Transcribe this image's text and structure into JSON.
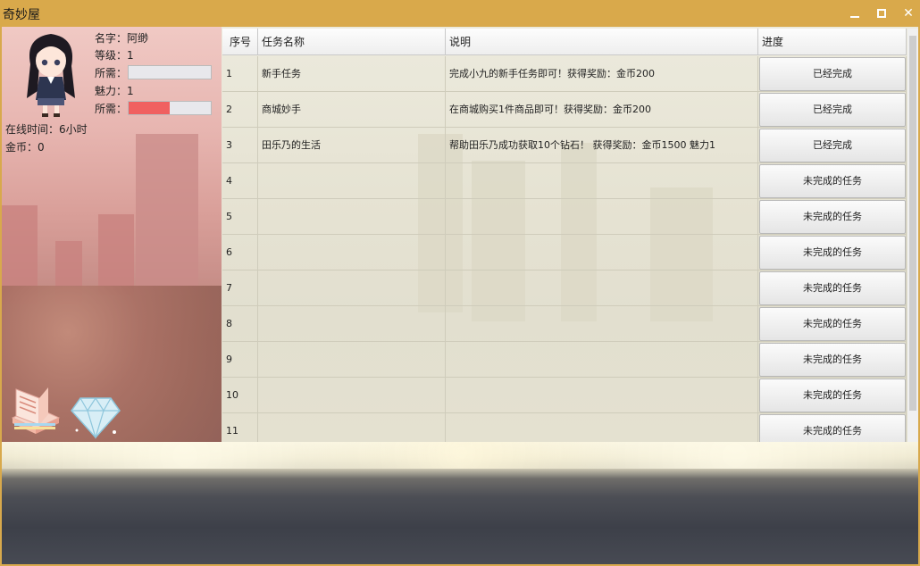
{
  "window": {
    "title": "奇妙屋"
  },
  "profile": {
    "name_label": "名字：阿缈",
    "level_label": "等级：1",
    "exp_label": "所需：",
    "exp_progress": 0.0,
    "charm_label": "魅力：1",
    "charm_need_label": "所需：",
    "charm_progress": 0.5,
    "online_label": "在线时间：6小时",
    "gold_label": "金币：0"
  },
  "table": {
    "headers": [
      "序号",
      "任务名称",
      "说明",
      "进度"
    ],
    "rows": [
      {
        "id": "1",
        "name": "新手任务",
        "desc": "完成小九的新手任务即可！获得奖励：金币200",
        "status": "已经完成"
      },
      {
        "id": "2",
        "name": "商城妙手",
        "desc": "在商城购买1件商品即可！获得奖励：金币200",
        "status": "已经完成"
      },
      {
        "id": "3",
        "name": "田乐乃的生活",
        "desc": "帮助田乐乃成功获取10个钻石！  获得奖励：金币1500 魅力1",
        "status": "已经完成"
      },
      {
        "id": "4",
        "name": "",
        "desc": "",
        "status": "未完成的任务"
      },
      {
        "id": "5",
        "name": "",
        "desc": "",
        "status": "未完成的任务"
      },
      {
        "id": "6",
        "name": "",
        "desc": "",
        "status": "未完成的任务"
      },
      {
        "id": "7",
        "name": "",
        "desc": "",
        "status": "未完成的任务"
      },
      {
        "id": "8",
        "name": "",
        "desc": "",
        "status": "未完成的任务"
      },
      {
        "id": "9",
        "name": "",
        "desc": "",
        "status": "未完成的任务"
      },
      {
        "id": "10",
        "name": "",
        "desc": "",
        "status": "未完成的任务"
      },
      {
        "id": "11",
        "name": "",
        "desc": "",
        "status": "未完成的任务"
      }
    ]
  },
  "icons": {
    "book": "book-icon",
    "diamond": "diamond-icon",
    "avatar": "avatar"
  }
}
